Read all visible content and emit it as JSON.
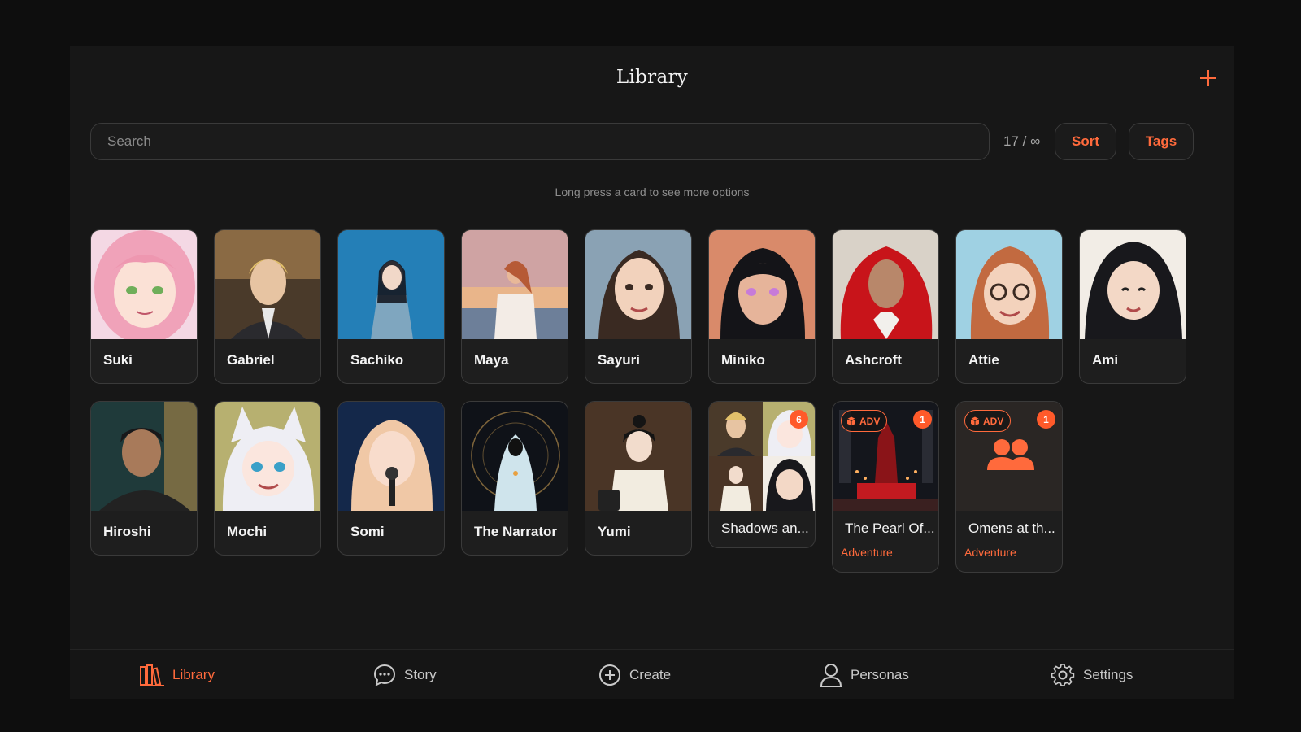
{
  "header": {
    "title": "Library"
  },
  "search": {
    "placeholder": "Search"
  },
  "toolbar": {
    "count": "17 / ∞",
    "sort_label": "Sort",
    "tags_label": "Tags"
  },
  "hint": "Long press a card to see more options",
  "characters": [
    {
      "name": "Suki"
    },
    {
      "name": "Gabriel"
    },
    {
      "name": "Sachiko"
    },
    {
      "name": "Maya"
    },
    {
      "name": "Sayuri"
    },
    {
      "name": "Miniko"
    },
    {
      "name": "Ashcroft"
    },
    {
      "name": "Attie"
    },
    {
      "name": "Ami"
    },
    {
      "name": "Hiroshi"
    },
    {
      "name": "Mochi"
    },
    {
      "name": "Somi"
    },
    {
      "name": "The Narrator"
    },
    {
      "name": "Yumi"
    }
  ],
  "groups": [
    {
      "name": "Shadows an...",
      "badge": "6"
    },
    {
      "name": "The Pearl Of...",
      "tag": "ADV",
      "badge": "1",
      "genre": "Adventure"
    },
    {
      "name": "Omens at th...",
      "tag": "ADV",
      "badge": "1",
      "genre": "Adventure"
    }
  ],
  "nav": [
    {
      "label": "Library",
      "icon": "library-icon"
    },
    {
      "label": "Story",
      "icon": "chat-icon"
    },
    {
      "label": "Create",
      "icon": "plus-circle-icon"
    },
    {
      "label": "Personas",
      "icon": "person-icon"
    },
    {
      "label": "Settings",
      "icon": "gear-icon"
    }
  ],
  "colors": {
    "accent": "#ff6a3c",
    "background": "#171717",
    "card": "#1e1e1e"
  }
}
